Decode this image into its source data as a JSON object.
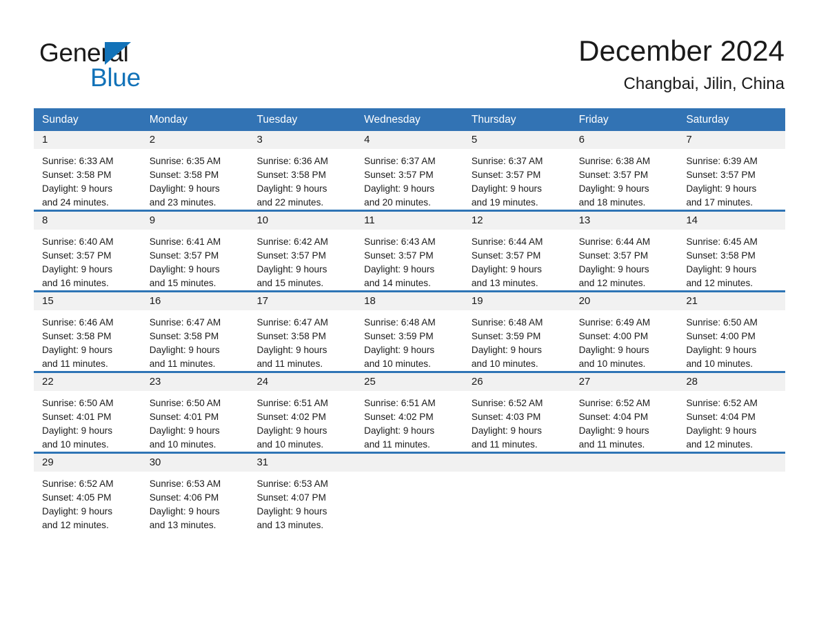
{
  "brand": {
    "name_part1": "General",
    "name_part2": "Blue",
    "accent_color": "#1272b8"
  },
  "header": {
    "title": "December 2024",
    "location": "Changbai, Jilin, China"
  },
  "theme": {
    "header_row_color": "#3273b4",
    "week_border_color": "#2e74b5",
    "daynum_band_color": "#f1f1f1"
  },
  "weekdays": [
    "Sunday",
    "Monday",
    "Tuesday",
    "Wednesday",
    "Thursday",
    "Friday",
    "Saturday"
  ],
  "weeks": [
    [
      {
        "day": "1",
        "sunrise": "Sunrise: 6:33 AM",
        "sunset": "Sunset: 3:58 PM",
        "daylight1": "Daylight: 9 hours",
        "daylight2": "and 24 minutes."
      },
      {
        "day": "2",
        "sunrise": "Sunrise: 6:35 AM",
        "sunset": "Sunset: 3:58 PM",
        "daylight1": "Daylight: 9 hours",
        "daylight2": "and 23 minutes."
      },
      {
        "day": "3",
        "sunrise": "Sunrise: 6:36 AM",
        "sunset": "Sunset: 3:58 PM",
        "daylight1": "Daylight: 9 hours",
        "daylight2": "and 22 minutes."
      },
      {
        "day": "4",
        "sunrise": "Sunrise: 6:37 AM",
        "sunset": "Sunset: 3:57 PM",
        "daylight1": "Daylight: 9 hours",
        "daylight2": "and 20 minutes."
      },
      {
        "day": "5",
        "sunrise": "Sunrise: 6:37 AM",
        "sunset": "Sunset: 3:57 PM",
        "daylight1": "Daylight: 9 hours",
        "daylight2": "and 19 minutes."
      },
      {
        "day": "6",
        "sunrise": "Sunrise: 6:38 AM",
        "sunset": "Sunset: 3:57 PM",
        "daylight1": "Daylight: 9 hours",
        "daylight2": "and 18 minutes."
      },
      {
        "day": "7",
        "sunrise": "Sunrise: 6:39 AM",
        "sunset": "Sunset: 3:57 PM",
        "daylight1": "Daylight: 9 hours",
        "daylight2": "and 17 minutes."
      }
    ],
    [
      {
        "day": "8",
        "sunrise": "Sunrise: 6:40 AM",
        "sunset": "Sunset: 3:57 PM",
        "daylight1": "Daylight: 9 hours",
        "daylight2": "and 16 minutes."
      },
      {
        "day": "9",
        "sunrise": "Sunrise: 6:41 AM",
        "sunset": "Sunset: 3:57 PM",
        "daylight1": "Daylight: 9 hours",
        "daylight2": "and 15 minutes."
      },
      {
        "day": "10",
        "sunrise": "Sunrise: 6:42 AM",
        "sunset": "Sunset: 3:57 PM",
        "daylight1": "Daylight: 9 hours",
        "daylight2": "and 15 minutes."
      },
      {
        "day": "11",
        "sunrise": "Sunrise: 6:43 AM",
        "sunset": "Sunset: 3:57 PM",
        "daylight1": "Daylight: 9 hours",
        "daylight2": "and 14 minutes."
      },
      {
        "day": "12",
        "sunrise": "Sunrise: 6:44 AM",
        "sunset": "Sunset: 3:57 PM",
        "daylight1": "Daylight: 9 hours",
        "daylight2": "and 13 minutes."
      },
      {
        "day": "13",
        "sunrise": "Sunrise: 6:44 AM",
        "sunset": "Sunset: 3:57 PM",
        "daylight1": "Daylight: 9 hours",
        "daylight2": "and 12 minutes."
      },
      {
        "day": "14",
        "sunrise": "Sunrise: 6:45 AM",
        "sunset": "Sunset: 3:58 PM",
        "daylight1": "Daylight: 9 hours",
        "daylight2": "and 12 minutes."
      }
    ],
    [
      {
        "day": "15",
        "sunrise": "Sunrise: 6:46 AM",
        "sunset": "Sunset: 3:58 PM",
        "daylight1": "Daylight: 9 hours",
        "daylight2": "and 11 minutes."
      },
      {
        "day": "16",
        "sunrise": "Sunrise: 6:47 AM",
        "sunset": "Sunset: 3:58 PM",
        "daylight1": "Daylight: 9 hours",
        "daylight2": "and 11 minutes."
      },
      {
        "day": "17",
        "sunrise": "Sunrise: 6:47 AM",
        "sunset": "Sunset: 3:58 PM",
        "daylight1": "Daylight: 9 hours",
        "daylight2": "and 11 minutes."
      },
      {
        "day": "18",
        "sunrise": "Sunrise: 6:48 AM",
        "sunset": "Sunset: 3:59 PM",
        "daylight1": "Daylight: 9 hours",
        "daylight2": "and 10 minutes."
      },
      {
        "day": "19",
        "sunrise": "Sunrise: 6:48 AM",
        "sunset": "Sunset: 3:59 PM",
        "daylight1": "Daylight: 9 hours",
        "daylight2": "and 10 minutes."
      },
      {
        "day": "20",
        "sunrise": "Sunrise: 6:49 AM",
        "sunset": "Sunset: 4:00 PM",
        "daylight1": "Daylight: 9 hours",
        "daylight2": "and 10 minutes."
      },
      {
        "day": "21",
        "sunrise": "Sunrise: 6:50 AM",
        "sunset": "Sunset: 4:00 PM",
        "daylight1": "Daylight: 9 hours",
        "daylight2": "and 10 minutes."
      }
    ],
    [
      {
        "day": "22",
        "sunrise": "Sunrise: 6:50 AM",
        "sunset": "Sunset: 4:01 PM",
        "daylight1": "Daylight: 9 hours",
        "daylight2": "and 10 minutes."
      },
      {
        "day": "23",
        "sunrise": "Sunrise: 6:50 AM",
        "sunset": "Sunset: 4:01 PM",
        "daylight1": "Daylight: 9 hours",
        "daylight2": "and 10 minutes."
      },
      {
        "day": "24",
        "sunrise": "Sunrise: 6:51 AM",
        "sunset": "Sunset: 4:02 PM",
        "daylight1": "Daylight: 9 hours",
        "daylight2": "and 10 minutes."
      },
      {
        "day": "25",
        "sunrise": "Sunrise: 6:51 AM",
        "sunset": "Sunset: 4:02 PM",
        "daylight1": "Daylight: 9 hours",
        "daylight2": "and 11 minutes."
      },
      {
        "day": "26",
        "sunrise": "Sunrise: 6:52 AM",
        "sunset": "Sunset: 4:03 PM",
        "daylight1": "Daylight: 9 hours",
        "daylight2": "and 11 minutes."
      },
      {
        "day": "27",
        "sunrise": "Sunrise: 6:52 AM",
        "sunset": "Sunset: 4:04 PM",
        "daylight1": "Daylight: 9 hours",
        "daylight2": "and 11 minutes."
      },
      {
        "day": "28",
        "sunrise": "Sunrise: 6:52 AM",
        "sunset": "Sunset: 4:04 PM",
        "daylight1": "Daylight: 9 hours",
        "daylight2": "and 12 minutes."
      }
    ],
    [
      {
        "day": "29",
        "sunrise": "Sunrise: 6:52 AM",
        "sunset": "Sunset: 4:05 PM",
        "daylight1": "Daylight: 9 hours",
        "daylight2": "and 12 minutes."
      },
      {
        "day": "30",
        "sunrise": "Sunrise: 6:53 AM",
        "sunset": "Sunset: 4:06 PM",
        "daylight1": "Daylight: 9 hours",
        "daylight2": "and 13 minutes."
      },
      {
        "day": "31",
        "sunrise": "Sunrise: 6:53 AM",
        "sunset": "Sunset: 4:07 PM",
        "daylight1": "Daylight: 9 hours",
        "daylight2": "and 13 minutes."
      },
      {
        "day": "",
        "sunrise": "",
        "sunset": "",
        "daylight1": "",
        "daylight2": ""
      },
      {
        "day": "",
        "sunrise": "",
        "sunset": "",
        "daylight1": "",
        "daylight2": ""
      },
      {
        "day": "",
        "sunrise": "",
        "sunset": "",
        "daylight1": "",
        "daylight2": ""
      },
      {
        "day": "",
        "sunrise": "",
        "sunset": "",
        "daylight1": "",
        "daylight2": ""
      }
    ]
  ]
}
